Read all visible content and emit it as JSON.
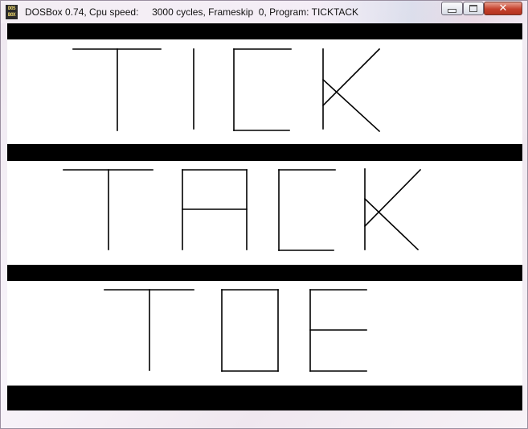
{
  "window": {
    "title": "DOSBox 0.74, Cpu speed:     3000 cycles, Frameskip  0, Program: TICKTACK",
    "app_icon_text": "DOS\nBOX",
    "controls": {
      "minimize": "minimize",
      "maximize": "maximize",
      "close": "close"
    }
  },
  "screen": {
    "background_color": "#000000",
    "band_color": "#ffffff",
    "stroke_color": "#000000",
    "words": [
      "TICK",
      "TACK",
      "TOE"
    ]
  }
}
